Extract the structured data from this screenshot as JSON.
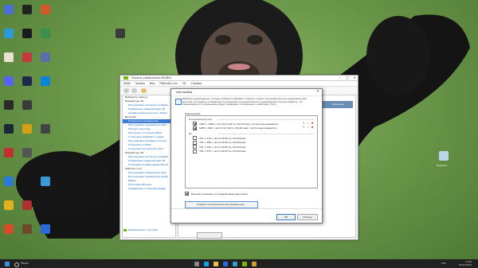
{
  "nvidia": {
    "title": "Панель управления NVIDIA",
    "menu": [
      "Файл",
      "Правка",
      "Вид",
      "Рабочий стол",
      "3D",
      "Справка"
    ],
    "sidebar_heading": "Выберите задачу...",
    "sidebar": [
      {
        "label": "Параметры 3D",
        "type": "head"
      },
      {
        "label": "Регулировка настроек изображ",
        "type": "sub"
      },
      {
        "label": "Управление параметрами 3D",
        "type": "sub"
      },
      {
        "label": "Конфигурация Surround, PhysX",
        "type": "sub"
      },
      {
        "label": "Дисплей",
        "type": "head"
      },
      {
        "label": "Изменение разрешения",
        "type": "sel"
      },
      {
        "label": "Регулировка параметров цвет",
        "type": "sub"
      },
      {
        "label": "Поворот дисплея",
        "type": "sub"
      },
      {
        "label": "Просмотр состояния HDCP",
        "type": "sub"
      },
      {
        "label": "Установка цифрового аудио",
        "type": "sub"
      },
      {
        "label": "Регулировка размера и полож",
        "type": "sub"
      },
      {
        "label": "Установка G-SYNC",
        "type": "sub"
      },
      {
        "label": "Установка нескольких дисп",
        "type": "sub"
      },
      {
        "label": "Параметры 3D",
        "type": "head"
      },
      {
        "label": "Регулировка настроек изображ",
        "type": "sub"
      },
      {
        "label": "Управление параметрами 3D",
        "type": "sub"
      },
      {
        "label": "Установка конфигурации PhysX",
        "type": "sub"
      },
      {
        "label": "Рабочий стол",
        "type": "head"
      },
      {
        "label": "Регулировка параметров цвет",
        "type": "sub"
      },
      {
        "label": "Регулировка параметров изобр",
        "type": "sub"
      },
      {
        "label": "Видео",
        "type": "sub"
      },
      {
        "label": "Настройка Мозаик",
        "type": "sub"
      },
      {
        "label": "Управление оттенками видео",
        "type": "sub"
      }
    ],
    "right_button": "Сведения",
    "footer_link": "Информация о системе",
    "apply": "Применить"
  },
  "dialog": {
    "title": "Настройки",
    "close": "✕",
    "description": "Выберите разрешения, которые требуется добавить. Можно создать пользовательское разрешение для дисплея, который не отображается (Создание пользовательского разрешения). Кнопка Удалить, что применяемое это разрешение будет проверено и применено к рабочему столу.",
    "permissions_label": "Разрешения:",
    "groups": [
      {
        "name": "Пользовательское",
        "items": [
          {
            "label": "1920 × 1080 с частотой 144 Гц (32-битная), построчная развертка",
            "checked": true,
            "actions": true
          },
          {
            "label": "1280 × 960 с частотой 144 Гц (32-битная), построчная развертка",
            "checked": true,
            "actions": true
          }
        ]
      },
      {
        "name": "PC",
        "items": [
          {
            "label": "720 × 576 с частотой 60 Гц (32-битная)",
            "checked": false,
            "actions": false
          },
          {
            "label": "720 × 480 с частотой 60 Гц (32-битная)",
            "checked": false,
            "actions": false
          },
          {
            "label": "720 × 400 с частотой 60 Гц (32-битная)",
            "checked": false,
            "actions": false
          },
          {
            "label": "720 × 576 с частотой 50 Гц (32-битная)",
            "checked": false,
            "actions": false
          }
        ]
      }
    ],
    "show_all_label": "Включить режимы, не предлагаемые дисплеем",
    "show_all_checked": true,
    "create_custom": "Создать пользовательское разрешение...",
    "ok": "ОК",
    "cancel": "Отмена"
  },
  "desktop": {
    "right_icon_label": "Корзина"
  },
  "taskbar": {
    "search": "Поиск",
    "tray": "РУС",
    "time": "13:26",
    "date": "26.05.2024"
  },
  "colors": {
    "nvidia_green": "#76b900",
    "accent_blue": "#3b7bd8",
    "taskbar": "#202020"
  }
}
